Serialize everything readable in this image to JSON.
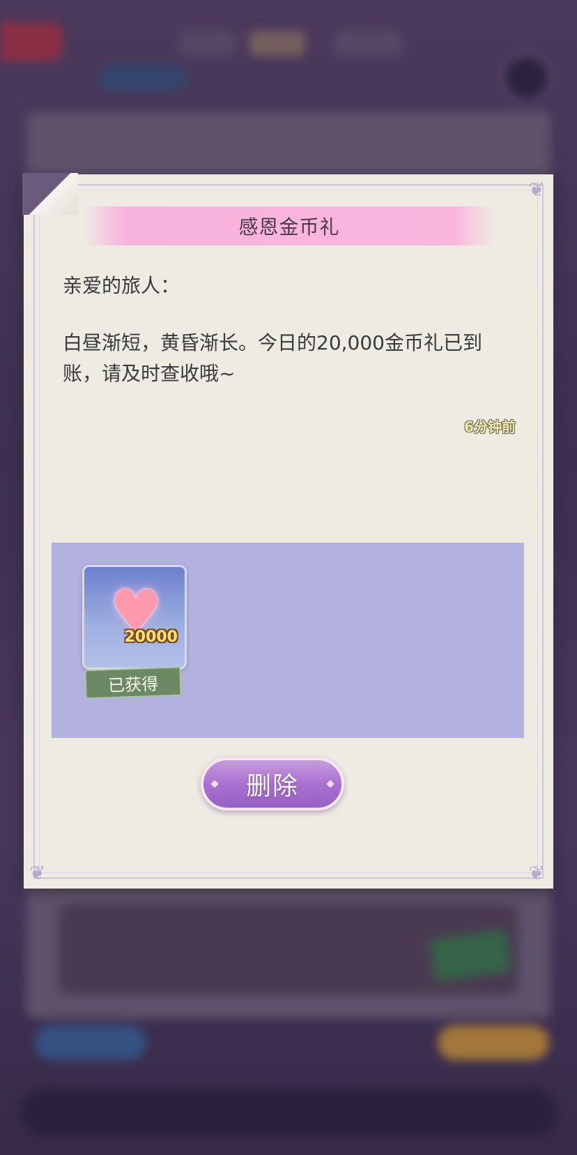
{
  "mail": {
    "title": "感恩金币礼",
    "greeting": "亲爱的旅人：",
    "body": "白昼渐短，黄昏渐长。今日的20,000金币礼已到账，请及时查收哦~",
    "time_ago": "6分钟前"
  },
  "reward": {
    "icon": "heart-icon",
    "amount": "20000",
    "status": "已获得"
  },
  "actions": {
    "delete_label": "删除"
  },
  "colors": {
    "title_banner": "#f8b3dd",
    "reward_area": "#b3b1de",
    "delete_button": "#a86dd0",
    "paper": "#eeebe3"
  }
}
